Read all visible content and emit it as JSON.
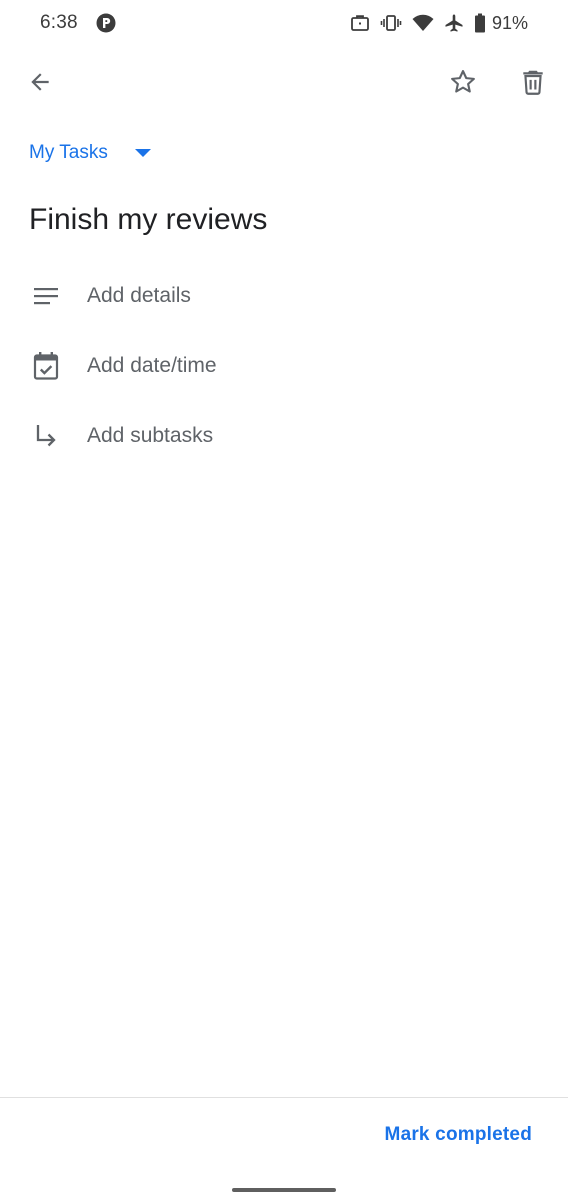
{
  "status_bar": {
    "time": "6:38",
    "battery_percent": "91%",
    "icons": [
      "app-notification-icon",
      "briefcase-icon",
      "vibrate-icon",
      "wifi-icon",
      "airplane-mode-icon",
      "battery-icon"
    ]
  },
  "app_bar": {
    "back_icon": "arrow-back-icon",
    "star_icon": "star-outline-icon",
    "delete_icon": "trash-icon"
  },
  "list_selector": {
    "label": "My Tasks",
    "icon": "caret-down-icon"
  },
  "task": {
    "title": "Finish my reviews"
  },
  "options": [
    {
      "label": "Add details",
      "icon": "notes-icon"
    },
    {
      "label": "Add date/time",
      "icon": "calendar-check-icon"
    },
    {
      "label": "Add subtasks",
      "icon": "subdirectory-arrow-icon"
    }
  ],
  "footer": {
    "mark_completed_label": "Mark completed"
  },
  "colors": {
    "accent": "#1a73e8",
    "icon_gray": "#5f6368",
    "text_primary": "#202124"
  }
}
